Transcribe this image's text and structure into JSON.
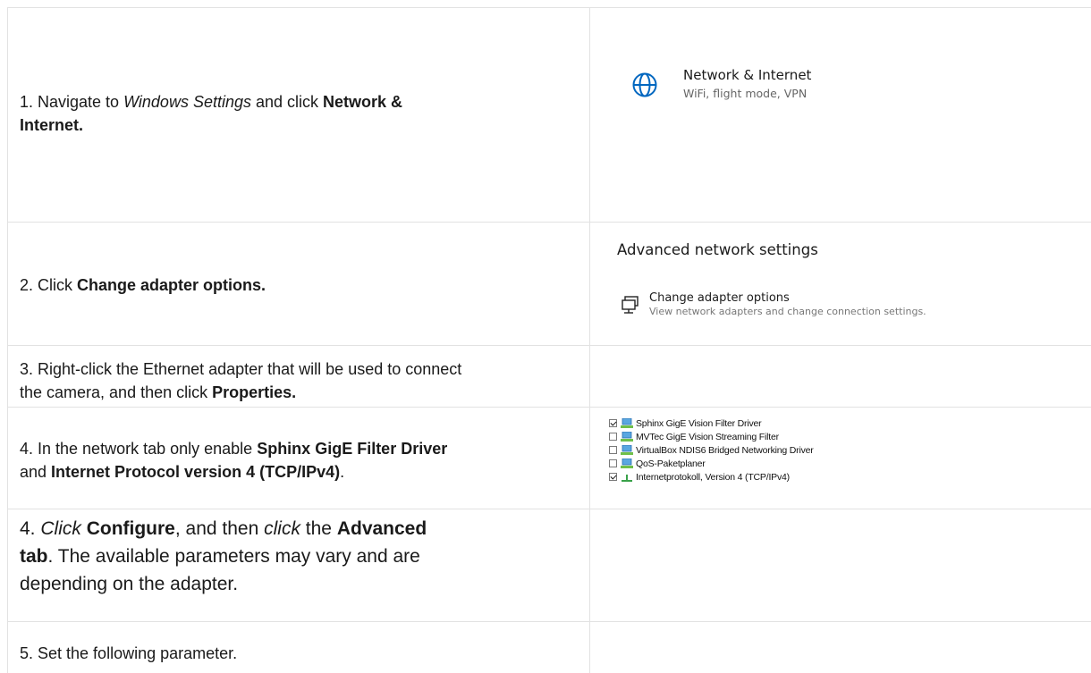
{
  "steps": [
    {
      "pre": "1. Navigate to ",
      "italic": "Windows Settings",
      "mid": " and click ",
      "bold": "Network &",
      "bold2": "Internet."
    },
    {
      "pre": "2. Click ",
      "bold": "Change adapter options."
    },
    {
      "line1": "3. Right-click the Ethernet adapter that will be used to connect",
      "line2_pre": "the camera, and then click ",
      "bold": "Properties."
    },
    {
      "line1_pre": "4. In the network tab only enable ",
      "bold1": "Sphinx GigE Filter Driver",
      "line2_pre": "and ",
      "bold2": "Internet Protocol version 4 (TCP/IPv4)",
      "line2_post": "."
    },
    {
      "pre": "4. ",
      "italic1": "Click",
      "sp1": " ",
      "bold1": "Configure",
      "mid": ", and then ",
      "italic2": "click",
      "post": " the ",
      "bold2": "Advanced",
      "bold3": "tab",
      "line2_post": ". The available parameters may vary and are",
      "line3": "depending on the adapter."
    },
    {
      "text": "5. Set the following parameter."
    }
  ],
  "network_tile": {
    "title": "Network & Internet",
    "subtitle": "WiFi, flight mode, VPN",
    "icon": "globe-icon"
  },
  "advanced": {
    "heading": "Advanced network settings",
    "item_title": "Change adapter options",
    "item_subtitle": "View network adapters and change connection settings.",
    "icon": "monitor-network-icon"
  },
  "components": [
    {
      "label": "Sphinx GigE Vision Filter Driver",
      "checked": true,
      "icon": "network-client-icon"
    },
    {
      "label": "MVTec GigE Vision Streaming Filter",
      "checked": false,
      "icon": "network-client-icon"
    },
    {
      "label": "VirtualBox NDIS6 Bridged Networking Driver",
      "checked": false,
      "icon": "network-client-icon"
    },
    {
      "label": "QoS-Paketplaner",
      "checked": false,
      "icon": "network-client-icon"
    },
    {
      "label": "Internetprotokoll, Version 4 (TCP/IPv4)",
      "checked": true,
      "icon": "protocol-icon"
    }
  ],
  "colors": {
    "accent": "#0067c0",
    "grid": "#e2e2e2"
  }
}
